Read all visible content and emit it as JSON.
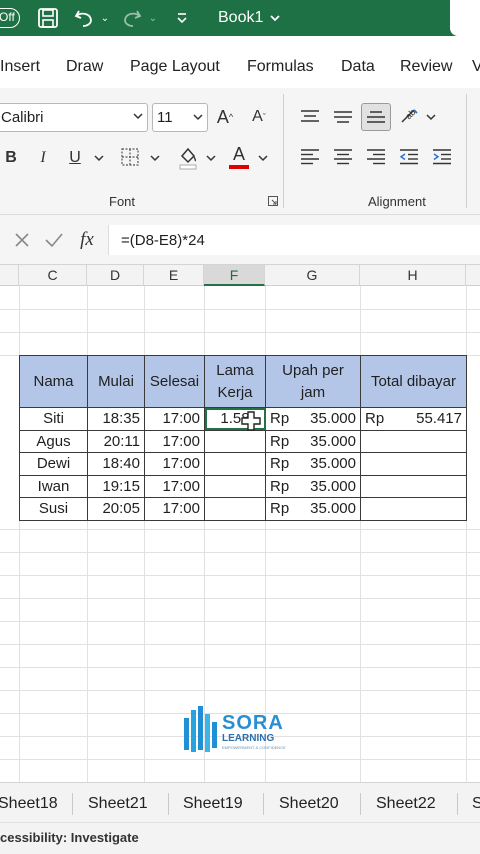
{
  "titlebar": {
    "autosave_label": "Off",
    "book_title": "Book1",
    "icons": [
      "save-icon",
      "undo-icon",
      "redo-icon",
      "customize-qat-icon",
      "chevron-down-icon"
    ]
  },
  "ribbon_tabs": [
    "Insert",
    "Draw",
    "Page Layout",
    "Formulas",
    "Data",
    "Review",
    "V"
  ],
  "font_group": {
    "font_name": "Calibri",
    "font_size": "11",
    "grow_label": "A",
    "shrink_label": "A",
    "bold": "B",
    "italic": "I",
    "underline": "U",
    "font_color_label": "A",
    "group_label": "Font"
  },
  "alignment_group": {
    "group_label": "Alignment"
  },
  "formula_bar": {
    "fx_label": "fx",
    "formula": "=(D8-E8)*24"
  },
  "columns": [
    {
      "label": "C",
      "selected": false
    },
    {
      "label": "D",
      "selected": false
    },
    {
      "label": "E",
      "selected": false
    },
    {
      "label": "F",
      "selected": true
    },
    {
      "label": "G",
      "selected": false
    },
    {
      "label": "H",
      "selected": false
    }
  ],
  "table": {
    "headers": {
      "nama": "Nama",
      "mulai": "Mulai",
      "selesai": "Selesai",
      "lama_1": "Lama",
      "lama_2": "Kerja",
      "upah_1": "Upah per",
      "upah_2": "jam",
      "total": "Total dibayar"
    },
    "rows": [
      {
        "nama": "Siti",
        "mulai": "18:35",
        "selesai": "17:00",
        "lama": "1.58",
        "upah_rp": "Rp",
        "upah": "35.000",
        "total_rp": "Rp",
        "total": "55.417"
      },
      {
        "nama": "Agus",
        "mulai": "20:11",
        "selesai": "17:00",
        "lama": "",
        "upah_rp": "Rp",
        "upah": "35.000",
        "total_rp": "",
        "total": ""
      },
      {
        "nama": "Dewi",
        "mulai": "18:40",
        "selesai": "17:00",
        "lama": "",
        "upah_rp": "Rp",
        "upah": "35.000",
        "total_rp": "",
        "total": ""
      },
      {
        "nama": "Iwan",
        "mulai": "19:15",
        "selesai": "17:00",
        "lama": "",
        "upah_rp": "Rp",
        "upah": "35.000",
        "total_rp": "",
        "total": ""
      },
      {
        "nama": "Susi",
        "mulai": "20:05",
        "selesai": "17:00",
        "lama": "",
        "upah_rp": "Rp",
        "upah": "35.000",
        "total_rp": "",
        "total": ""
      }
    ]
  },
  "logo": {
    "brand": "SORA",
    "brand2": "LEARNING",
    "tagline": "EMPOWERMENT & CONFIDENCE"
  },
  "sheets": [
    "Sheet18",
    "Sheet21",
    "Sheet19",
    "Sheet20",
    "Sheet22",
    "S"
  ],
  "status": {
    "text": "cessibility: Investigate"
  },
  "colors": {
    "excel_green": "#1e7145",
    "header_fill": "#b4c6e7",
    "font_color_bar": "#e00000"
  }
}
